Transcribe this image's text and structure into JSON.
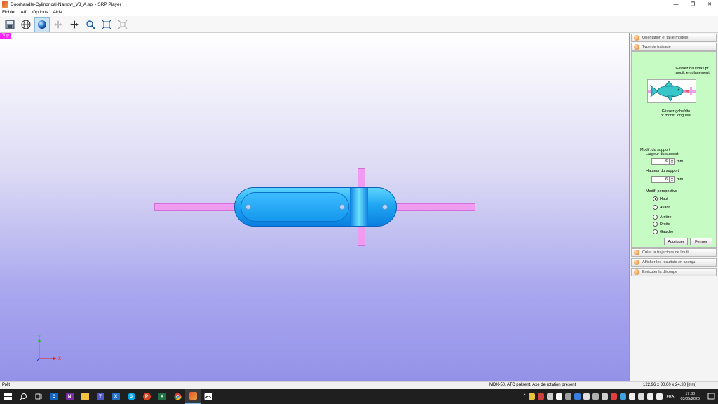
{
  "window": {
    "title": "Doorhandle-Cylindrical-Narrow_V3_A.spj - SRP Player",
    "minimize_glyph": "—",
    "maximize_glyph": "❐",
    "close_glyph": "✕"
  },
  "menu": {
    "items": [
      "Fichier",
      "Aff.",
      "Options",
      "Aide"
    ]
  },
  "toolbar": {
    "buttons": [
      "save-icon",
      "globe-grid-icon",
      "sphere-render-icon",
      "move-disabled-icon",
      "move-icon",
      "zoom-icon",
      "fit-view-icon",
      "fit-disabled-icon"
    ],
    "active_index": 2
  },
  "viewport": {
    "view_label": "Top",
    "axis_x": "X",
    "axis_y": "Y",
    "model_color": "#1fa6f2",
    "support_color": "#ef9bf0"
  },
  "panel": {
    "sections_top": [
      "Orientation et taille modèle",
      "Type de fraisage"
    ],
    "hint_vertical_1": "Glissez haut/bas pr",
    "hint_vertical_2": "modif. emplacement",
    "hint_horizontal_1": "Glissez gche/dte",
    "hint_horizontal_2": "pr modif. longueur",
    "support_heading": "Modif. du support",
    "width_label": "Largeur du support",
    "width_value": "6",
    "height_label": "Hauteur du support",
    "height_value": "6",
    "unit": "mm",
    "perspective_label": "Modif. perspective",
    "perspectives": [
      "Haut",
      "Avant",
      "Arrière",
      "Droite",
      "Gauche"
    ],
    "perspective_selected": "Haut",
    "apply_label": "Appliquer",
    "close_label": "Fermer",
    "sections_bottom": [
      "Créer la trajectoire de l'outil",
      "Afficher les résultats en aperçu",
      "Exécuter la découpe"
    ]
  },
  "status": {
    "left": "Prêt",
    "center": "MDX-50, ATC présent, Axe de rotation présent",
    "right": "122,96 x 30,00 x 24,30 [mm]"
  },
  "taskbar": {
    "language": "FRA",
    "time": "17:30",
    "date": "03/05/2020"
  }
}
